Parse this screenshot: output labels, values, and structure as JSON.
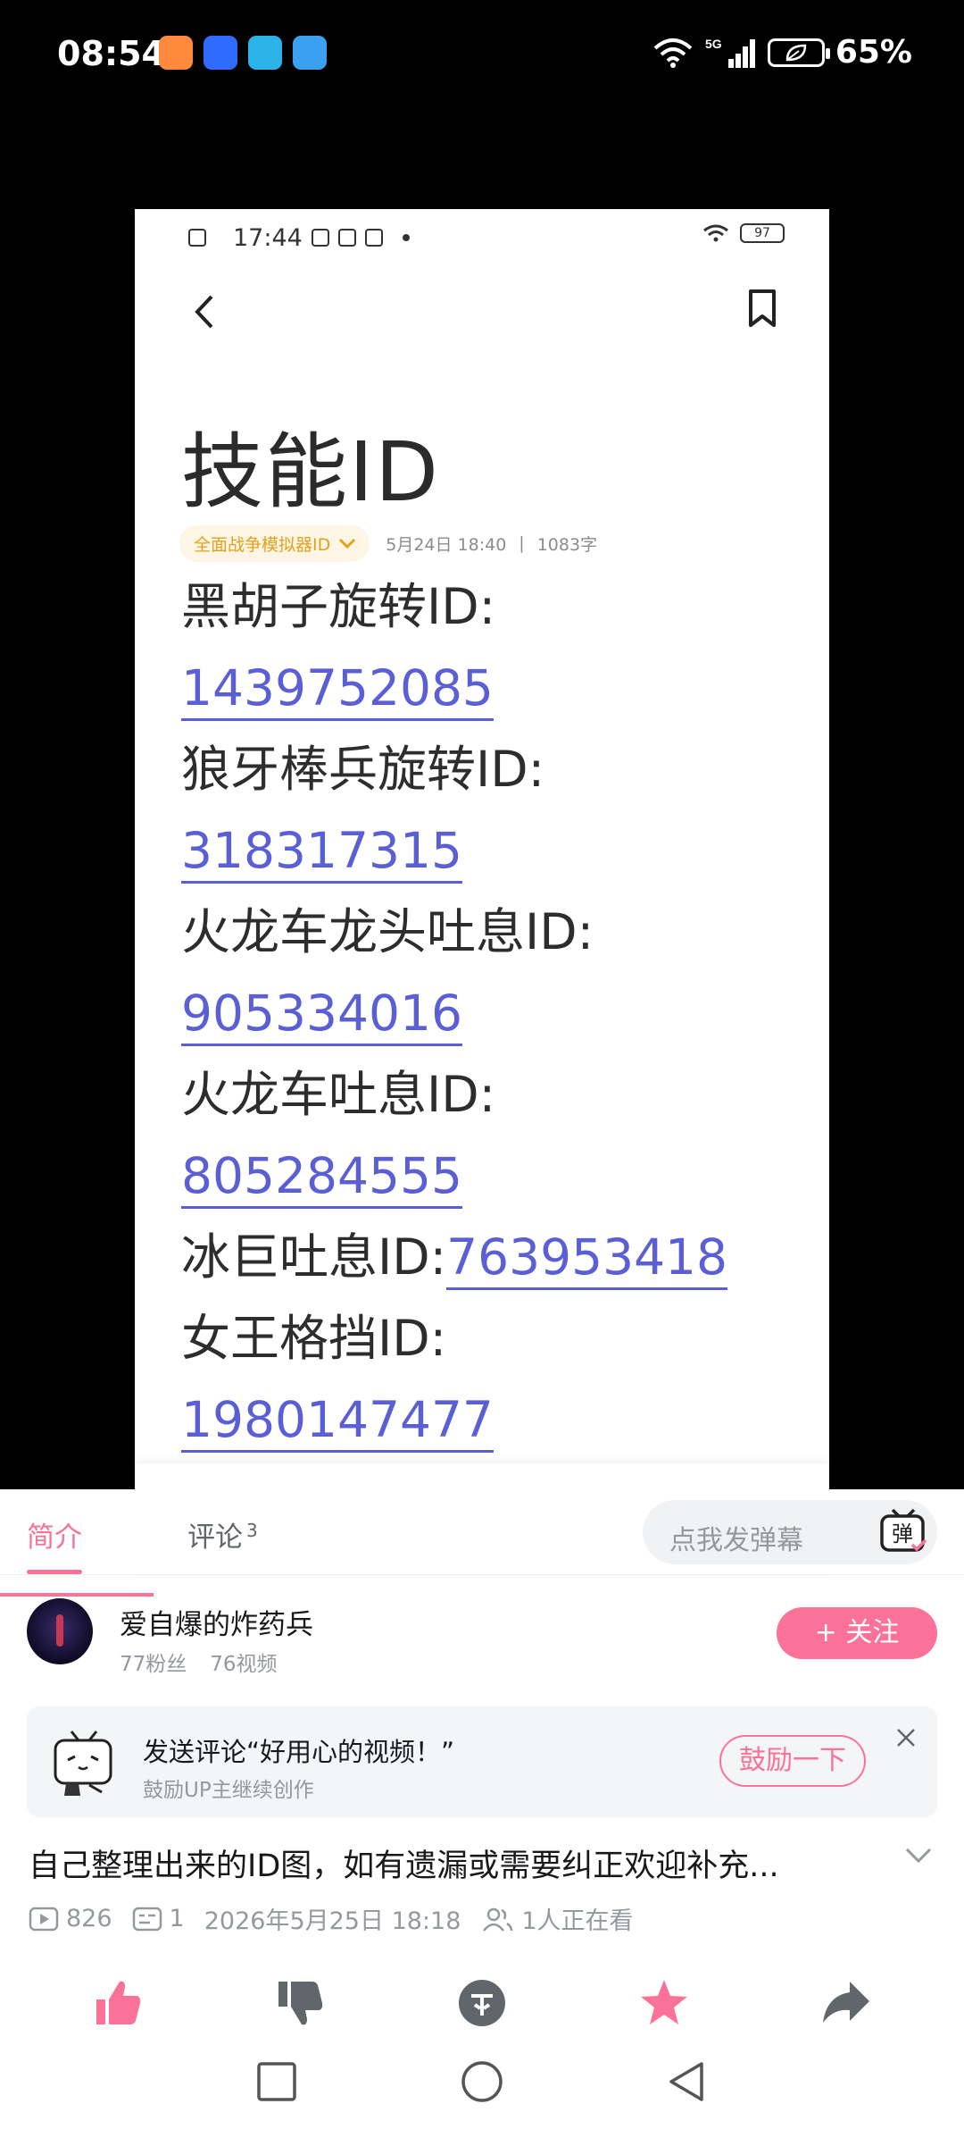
{
  "status_bar": {
    "time": "08:54",
    "battery": "65%",
    "network": "5G",
    "app_badge_colors": [
      "#ff8a3d",
      "#2f6bff",
      "#2bb3e8",
      "#3aa0f0"
    ]
  },
  "video_frame": {
    "inner_status": {
      "time": "17:44",
      "battery": "97"
    },
    "note": {
      "title": "技能ID",
      "folder": "全面战争模拟器ID",
      "date": "5月24日 18:40",
      "separator": "|",
      "word_count": "1083字",
      "lines": [
        {
          "label": "黑胡子旋转ID:",
          "id": ""
        },
        {
          "label": "",
          "id": "1439752085"
        },
        {
          "label": "狼牙棒兵旋转ID:",
          "id": ""
        },
        {
          "label": "",
          "id": "318317315"
        },
        {
          "label": "火龙车龙头吐息ID:",
          "id": ""
        },
        {
          "label": "",
          "id": "905334016"
        },
        {
          "label": "火龙车吐息ID:",
          "id": ""
        },
        {
          "label": "",
          "id": "805284555"
        },
        {
          "label": "冰巨吐息ID:",
          "id": "763953418"
        },
        {
          "label": "女王格挡ID:",
          "id": ""
        },
        {
          "label": "",
          "id": "1980147477"
        }
      ]
    },
    "toolbar_icons": [
      "alarm-icon",
      "shirt-icon",
      "trash-icon",
      "pin-icon",
      "lock-icon",
      "more-icon"
    ]
  },
  "tabs": {
    "intro": "简介",
    "comments": "评论",
    "comment_count": "3",
    "danmaku_placeholder": "点我发弹幕",
    "danmaku_button": "弹"
  },
  "uploader": {
    "name": "爱自爆的炸药兵",
    "fans": "77粉丝",
    "videos": "76视频",
    "follow": "+ 关注"
  },
  "encourage": {
    "title": "发送评论“好用心的视频！”",
    "subtitle": "鼓励UP主继续创作",
    "button": "鼓励一下"
  },
  "video_info": {
    "title": "自己整理出来的ID图，如有遗漏或需要纠正欢迎补充...",
    "views": "826",
    "danmaku_count": "1",
    "date": "2026年5月25日 18:18",
    "watching": "1人正在看"
  },
  "colors": {
    "accent": "#fb7299",
    "link": "#5b5fd6",
    "folder": "#e3a21a"
  }
}
